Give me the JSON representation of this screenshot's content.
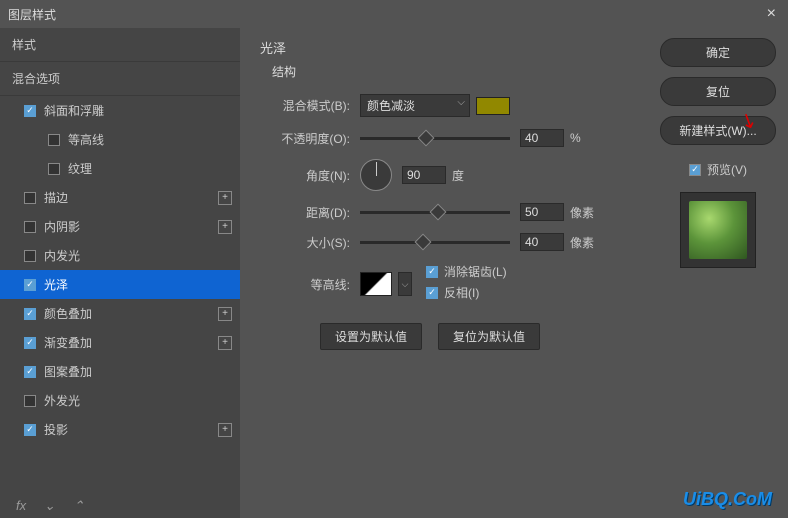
{
  "title": "图层样式",
  "left": {
    "styles_header": "样式",
    "blend_header": "混合选项",
    "items": [
      {
        "label": "斜面和浮雕",
        "checked": true,
        "add": false
      },
      {
        "label": "等高线",
        "checked": false,
        "indent": true
      },
      {
        "label": "纹理",
        "checked": false,
        "indent": true
      },
      {
        "label": "描边",
        "checked": false,
        "add": true
      },
      {
        "label": "内阴影",
        "checked": false,
        "add": true
      },
      {
        "label": "内发光",
        "checked": false,
        "add": false
      },
      {
        "label": "光泽",
        "checked": true,
        "selected": true
      },
      {
        "label": "颜色叠加",
        "checked": true,
        "add": true
      },
      {
        "label": "渐变叠加",
        "checked": true,
        "add": true
      },
      {
        "label": "图案叠加",
        "checked": true,
        "add": false
      },
      {
        "label": "外发光",
        "checked": false,
        "add": false
      },
      {
        "label": "投影",
        "checked": true,
        "add": true
      }
    ]
  },
  "center": {
    "title": "光泽",
    "subtitle": "结构",
    "blend_mode_label": "混合模式(B):",
    "blend_mode_value": "颜色减淡",
    "color_hex": "#918800",
    "opacity_label": "不透明度(O):",
    "opacity_value": "40",
    "opacity_unit": "%",
    "angle_label": "角度(N):",
    "angle_value": "90",
    "angle_unit": "度",
    "distance_label": "距离(D):",
    "distance_value": "50",
    "distance_unit": "像素",
    "size_label": "大小(S):",
    "size_value": "40",
    "size_unit": "像素",
    "contour_label": "等高线:",
    "antialias_label": "消除锯齿(L)",
    "invert_label": "反相(I)",
    "make_default": "设置为默认值",
    "reset_default": "复位为默认值"
  },
  "right": {
    "ok": "确定",
    "cancel": "复位",
    "new_style": "新建样式(W)...",
    "preview": "预览(V)"
  },
  "watermark": "UiBQ.CoM"
}
